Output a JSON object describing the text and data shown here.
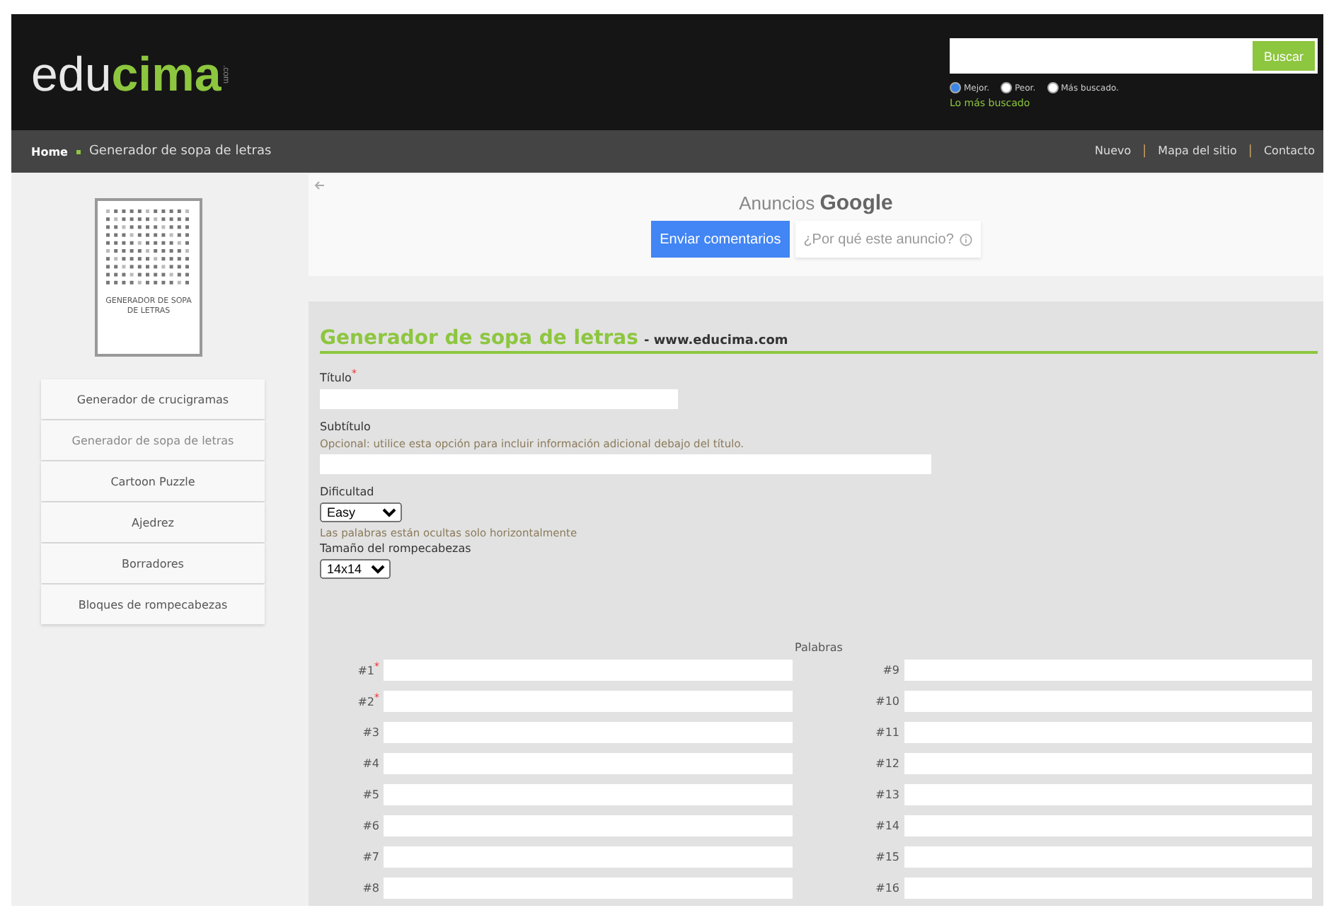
{
  "header": {
    "logo_light": "edu",
    "logo_bold": "cima",
    "logo_tld": ".com",
    "search": {
      "button": "Buscar"
    },
    "search_options": [
      {
        "label": "Mejor.",
        "selected": true
      },
      {
        "label": "Peor.",
        "selected": false
      },
      {
        "label": "Más buscado.",
        "selected": false
      }
    ],
    "popular_link": "Lo más buscado"
  },
  "breadcrumb": {
    "home": "Home",
    "current": "Generador de sopa de letras"
  },
  "top_links": [
    {
      "label": "Nuevo",
      "separator": "|"
    },
    {
      "label": "Mapa del sitio",
      "separator": "|"
    },
    {
      "label": "Contacto"
    }
  ],
  "sidebar": {
    "thumbnail_caption": "GENERADOR DE SOPA DE LETRAS",
    "items": [
      {
        "label": "Generador de crucigramas",
        "selected": false
      },
      {
        "label": "Generador de sopa de letras",
        "selected": true
      },
      {
        "label": "Cartoon Puzzle",
        "selected": false
      },
      {
        "label": "Ajedrez",
        "selected": false
      },
      {
        "label": "Borradores",
        "selected": false
      },
      {
        "label": "Bloques de rompecabezas",
        "selected": false
      }
    ]
  },
  "ad": {
    "title": "Anuncios **Google**",
    "feedback_button": "Enviar comentarios",
    "why_button": "¿Por qué este anuncio?"
  },
  "form": {
    "heading": "Generador de sopa de letras",
    "heading_site": "- www.educima.com",
    "required_mark": "*",
    "title_field": {
      "label": "Título",
      "required": true
    },
    "subtitle_field": {
      "label": "Subtítulo",
      "hint": "Opcional: utilice esta opción para incluir información adicional debajo del título."
    },
    "difficulty": {
      "label": "Dificultad",
      "value": "Easy",
      "hint": "Las palabras están ocultas solo horizontalmente"
    },
    "size": {
      "label": "Tamaño del rompecabezas",
      "value": "14x14"
    },
    "words_heading": "Palabras",
    "words_left": [
      {
        "label": "#1",
        "required": true
      },
      {
        "label": "#2",
        "required": true
      },
      {
        "label": "#3",
        "required": false
      },
      {
        "label": "#4",
        "required": false
      },
      {
        "label": "#5",
        "required": false
      },
      {
        "label": "#6",
        "required": false
      },
      {
        "label": "#7",
        "required": false
      },
      {
        "label": "#8",
        "required": false
      }
    ],
    "words_right": [
      {
        "label": "#9",
        "required": false
      },
      {
        "label": "#10",
        "required": false
      },
      {
        "label": "#11",
        "required": false
      },
      {
        "label": "#12",
        "required": false
      },
      {
        "label": "#13",
        "required": false
      },
      {
        "label": "#14",
        "required": false
      },
      {
        "label": "#15",
        "required": false
      },
      {
        "label": "#16",
        "required": false
      }
    ]
  }
}
